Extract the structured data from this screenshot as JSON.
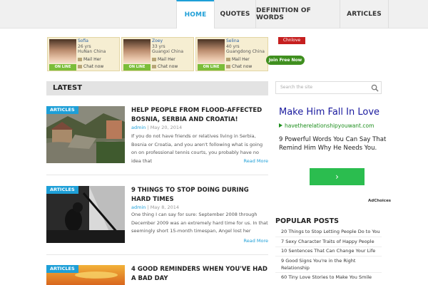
{
  "nav": {
    "items": [
      {
        "label": "HOME",
        "active": true
      },
      {
        "label": "QUOTES",
        "active": false
      },
      {
        "label": "DEFINITION OF WORDS",
        "active": false
      },
      {
        "label": "ARTICLES",
        "active": false
      }
    ]
  },
  "banner": {
    "profiles": [
      {
        "name": "Sofia",
        "age": "26 yrs",
        "location": "HuNan China",
        "mail": "Mail Her",
        "chat": "Chat now",
        "status": "ON LINE"
      },
      {
        "name": "Zoey",
        "age": "33 yrs",
        "location": "Guangxi China",
        "mail": "Mail Her",
        "chat": "Chat now",
        "status": "ON LINE"
      },
      {
        "name": "Selina",
        "age": "40 yrs",
        "location": "Guangdong China",
        "mail": "Mail Her",
        "chat": "Chat now",
        "status": "ON LINE"
      }
    ],
    "logo": "Chnlove",
    "join_label": "Join Free Now"
  },
  "latest": {
    "heading": "LATEST"
  },
  "posts": [
    {
      "category": "ARTICLES",
      "title": "HELP PEOPLE FROM FLOOD-AFFECTED BOSNIA, SERBIA AND CROATIA!",
      "author": "admin",
      "date": "May 20, 2014",
      "excerpt": "If you do not have friends or relatives living in Serbia, Bosnia or Croatia, and you aren't following what is going on on professional tennis courts, you probably have no idea that",
      "more": "Read More"
    },
    {
      "category": "ARTICLES",
      "title": "9 THINGS TO STOP DOING DURING HARD TIMES",
      "author": "admin",
      "date": "May 8, 2014",
      "excerpt": "One thing I can say for sure: September 2008 through December 2009 was an extremely hard time for us. In that seemingly short 15-month timespan, Angel lost her",
      "more": "Read More"
    },
    {
      "category": "ARTICLES",
      "title": "4 GOOD REMINDERS WHEN YOU'VE HAD A BAD DAY",
      "author": "",
      "date": "",
      "excerpt": "",
      "more": ""
    }
  ],
  "sidebar": {
    "search_placeholder": "Search the site",
    "ad": {
      "title": "Make Him Fall In Love",
      "url": "havetherelationshipyouwant.com",
      "text": "9 Powerful Words You Can Say That Remind Him Why He Needs You.",
      "button": "›",
      "adchoices": "AdChoices"
    },
    "popular": {
      "heading": "POPULAR POSTS",
      "items": [
        "20 Things to Stop Letting People Do to You",
        "7 Sexy Character Traits of Happy People",
        "10 Sentences That Can Change Your Life",
        "9 Good Signs You're in the Right Relationship",
        "60 Tiny Love Stories to Make You Smile"
      ]
    }
  },
  "colors": {
    "accent": "#1e9fd7",
    "ad_green": "#2bbd4f",
    "join_green": "#3f8f1f"
  }
}
